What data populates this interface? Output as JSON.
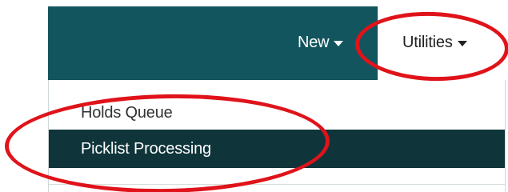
{
  "navbar": {
    "new_label": "New",
    "utilities_label": "Utilities"
  },
  "dropdown": {
    "items": [
      {
        "label": "Holds Queue"
      },
      {
        "label": "Picklist Processing"
      }
    ]
  },
  "colors": {
    "navbar_bg": "#12555e",
    "active_item_bg": "#0f353b",
    "annotation": "#e0131a"
  }
}
